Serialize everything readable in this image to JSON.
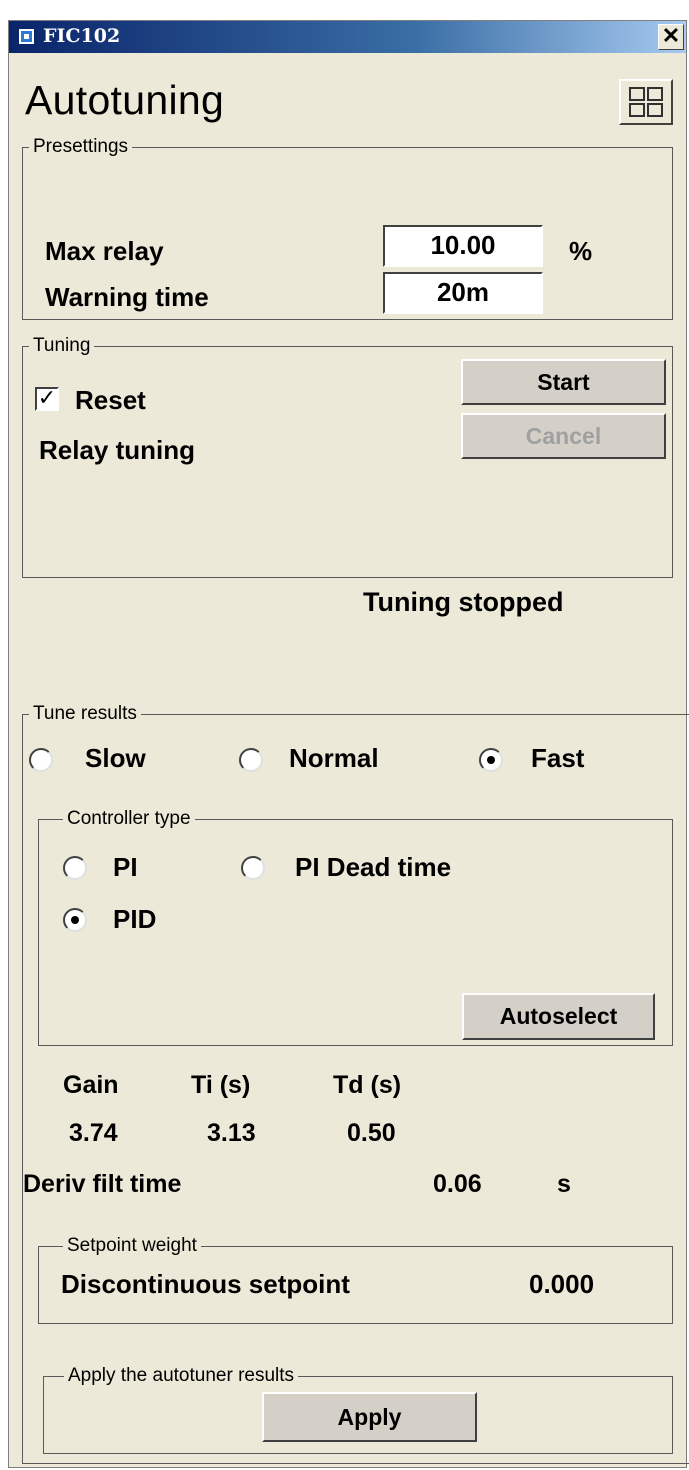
{
  "window": {
    "title": "FIC102",
    "close_glyph": "✕",
    "close_icon": "close-icon"
  },
  "header": {
    "title": "Autotuning",
    "grid_icon": "grid-icon"
  },
  "presettings": {
    "legend": "Presettings",
    "max_relay_label": "Max relay",
    "max_relay_value": "10.00",
    "max_relay_unit": "%",
    "warning_time_label": "Warning time",
    "warning_time_value": "20m"
  },
  "tuning": {
    "legend": "Tuning",
    "reset_label": "Reset",
    "reset_checked": true,
    "check_glyph": "✓",
    "mode_label": "Relay tuning",
    "start_label": "Start",
    "cancel_label": "Cancel",
    "status": "Tuning stopped"
  },
  "tune_results": {
    "legend": "Tune results",
    "speed_options": [
      "Slow",
      "Normal",
      "Fast"
    ],
    "speed_selected": "Fast",
    "controller_type": {
      "legend": "Controller type",
      "options": [
        "PI",
        "PI Dead time",
        "PID"
      ],
      "selected": "PID",
      "autoselect_label": "Autoselect"
    },
    "params": {
      "headers": [
        "Gain",
        "Ti (s)",
        "Td (s)"
      ],
      "values": [
        "3.74",
        "3.13",
        "0.50"
      ]
    },
    "deriv_filt": {
      "label": "Deriv filt time",
      "value": "0.06",
      "unit": "s"
    },
    "setpoint_weight": {
      "legend": "Setpoint weight",
      "label": "Discontinuous setpoint",
      "value": "0.000"
    },
    "apply": {
      "legend": "Apply the autotuner results",
      "button_label": "Apply"
    }
  }
}
